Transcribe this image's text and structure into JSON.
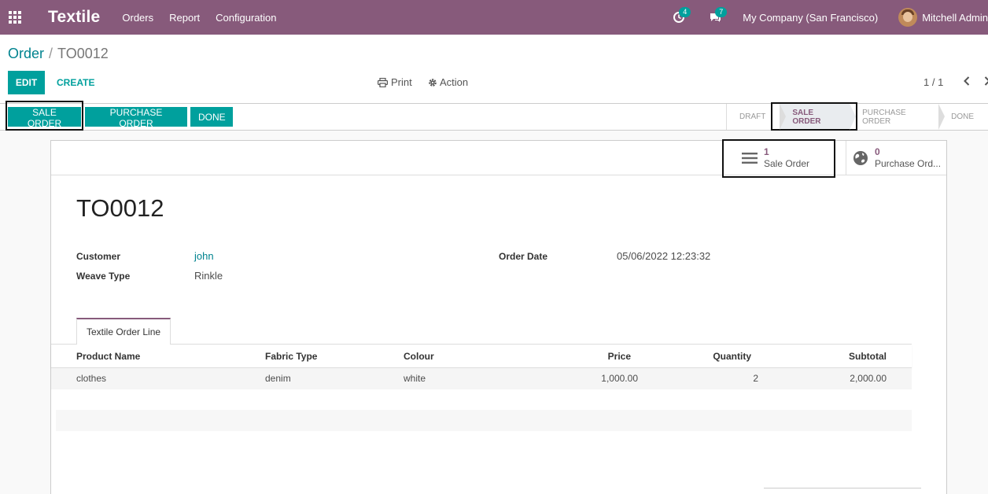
{
  "navbar": {
    "app_title": "Textile",
    "menu": [
      "Orders",
      "Report",
      "Configuration"
    ],
    "activity_count": "4",
    "messages_count": "7",
    "company": "My Company (San Francisco)",
    "user": "Mitchell Admin",
    "bg_color": "#875a7b"
  },
  "breadcrumb": {
    "parent": "Order",
    "separator": "/",
    "current": "TO0012"
  },
  "toolbar": {
    "edit_label": "EDIT",
    "create_label": "CREATE",
    "print_label": "Print",
    "action_label": "Action",
    "pager": "1 / 1"
  },
  "statusbar": {
    "buttons": [
      "SALE ORDER",
      "PURCHASE ORDER",
      "DONE"
    ],
    "stages": [
      "DRAFT",
      "SALE ORDER",
      "PURCHASE ORDER",
      "DONE"
    ],
    "active_stage": "SALE ORDER"
  },
  "smart_buttons": [
    {
      "count": "1",
      "label": "Sale Order",
      "icon": "list-icon"
    },
    {
      "count": "0",
      "label": "Purchase Ord...",
      "icon": "globe-icon"
    }
  ],
  "record": {
    "title": "TO0012",
    "customer_label": "Customer",
    "customer": "john",
    "weave_label": "Weave Type",
    "weave": "Rinkle",
    "date_label": "Order Date",
    "date": "05/06/2022 12:23:32"
  },
  "notebook": {
    "tab": "Textile Order Line",
    "columns": [
      "Product Name",
      "Fabric Type",
      "Colour",
      "Price",
      "Quantity",
      "Subtotal"
    ],
    "rows": [
      [
        "clothes",
        "denim",
        "white",
        "1,000.00",
        "2",
        "2,000.00"
      ]
    ]
  },
  "accent_color": "#00a09d"
}
